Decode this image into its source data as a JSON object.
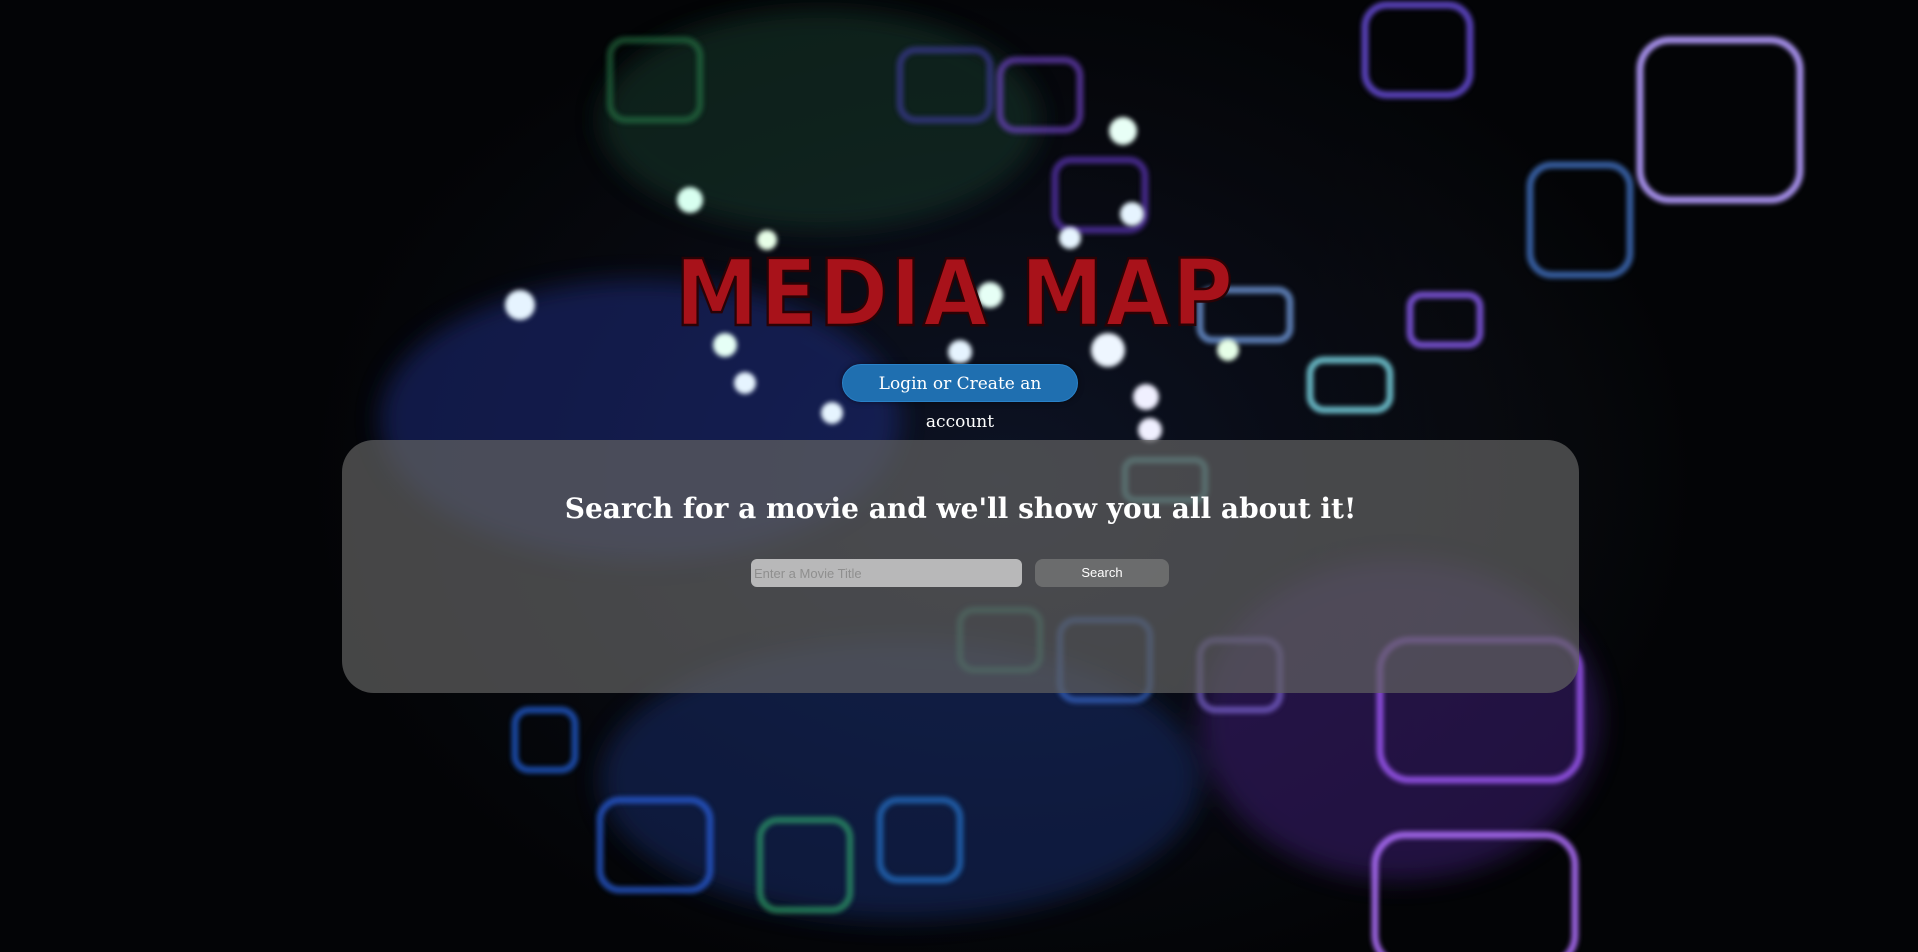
{
  "header": {
    "logo_text": "MEDIA MAP",
    "login_label": "Login or Create an account"
  },
  "search": {
    "heading": "Search for a movie and we'll show you all about it!",
    "placeholder": "Enter a Movie Title",
    "button_label": "Search"
  },
  "colors": {
    "logo_red": "#a8121a",
    "login_button": "#1f6fb0",
    "panel": "#5f5f5f"
  }
}
